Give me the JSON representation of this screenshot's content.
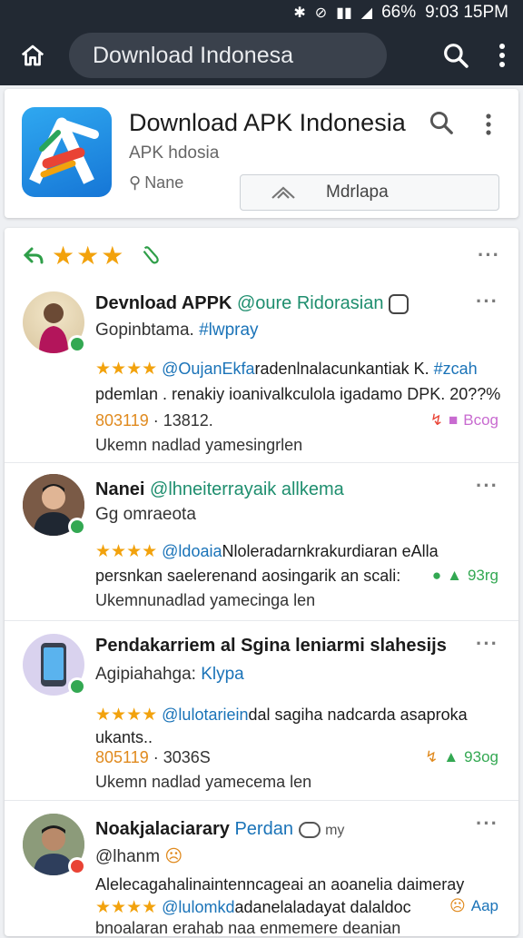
{
  "status": {
    "battery": "66%",
    "time": "9:03 15PM"
  },
  "appbar": {
    "search_text": "Download Indonesa"
  },
  "app": {
    "title": "Download APK Indonesia",
    "subtitle": "APK hdosia",
    "meta": "Nane",
    "install_label": "Mdrlapa"
  },
  "feed": {
    "header_stars": "★★★"
  },
  "posts": [
    {
      "name": "Devnload APPK",
      "handle": "@oure Ridorasian",
      "sub": "Gopinbtama.",
      "tag": "#lwpray",
      "stars": "★★★★",
      "mention": "@OujanEkfa",
      "line": "radenlnalacunkantiak K.",
      "hashtag": "#zcah",
      "text": "pdemlan . renakiy ioanivalkculola igadamo DPK. 20??%a",
      "date": "803119",
      "date_rest": " · 13812.",
      "reaction": "Bcog",
      "footer": "Ukemn nadlad yamesingrlen"
    },
    {
      "name": "Nanei",
      "handle": "@lhneiterrayaik allkema",
      "sub": "Gg omraeota",
      "stars": "★★★★",
      "mention": "@ldoaia",
      "line": "Nloleradarnkrakurdiaran eAlla",
      "text": "persnkan saelerenand aosingarik an scali:",
      "reaction": "93rg",
      "footer": "Ukemnunadlad yamecinga len"
    },
    {
      "name": "Pendakarriem al Sgina leniarmi slahesijs",
      "sub": "Agipiahahga:",
      "tag": "Klypa",
      "stars": "★★★★",
      "mention": "@lulotariein",
      "line": "dal sagiha nadcarda asaproka",
      "text": "ukants..",
      "date": "805119",
      "date_rest": " · 3036S",
      "reaction": "93og",
      "footer": "Ukemn nadlad yamecema len"
    },
    {
      "name": "Noakjalaciarary",
      "handle": "Perdan",
      "handle2": "my",
      "sub": "@lhanm",
      "stars": "★★★★",
      "mention": "@lulomkd",
      "line": "adanelaladayat dalaldoc",
      "line_pre": "Alelecagahalinaintenncageai an aoanelia daimeray",
      "reaction": "Aap",
      "footer": "bnoalaran erahab naa enmemere deanian"
    }
  ],
  "colors": {
    "bar": "#222933",
    "star": "#f2a20d",
    "link": "#1a73b8",
    "green": "#33a852"
  }
}
